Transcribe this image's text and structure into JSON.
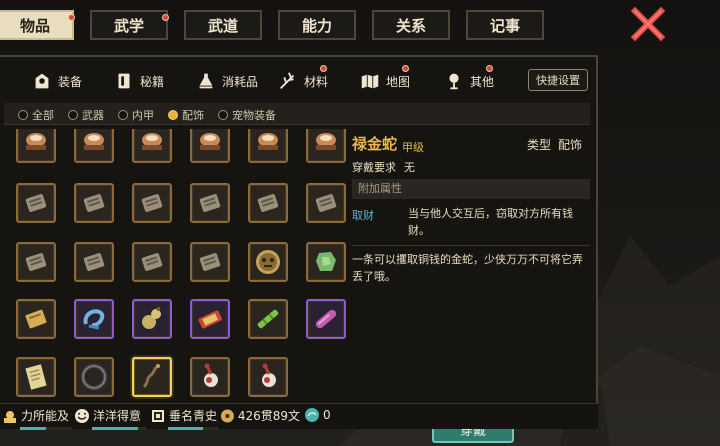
{
  "top_tabs": [
    {
      "label": "物品",
      "badge": true,
      "active": true
    },
    {
      "label": "武学",
      "badge": true,
      "active": false
    },
    {
      "label": "武道",
      "badge": false,
      "active": false
    },
    {
      "label": "能力",
      "badge": false,
      "active": false
    },
    {
      "label": "关系",
      "badge": false,
      "active": false
    },
    {
      "label": "记事",
      "badge": false,
      "active": false
    }
  ],
  "sub_tabs": [
    {
      "label": "装备",
      "icon": "armor-icon",
      "badge": false,
      "active": true
    },
    {
      "label": "秘籍",
      "icon": "book-icon",
      "badge": false,
      "active": false
    },
    {
      "label": "消耗品",
      "icon": "potion-icon",
      "badge": false,
      "active": false
    },
    {
      "label": "材料",
      "icon": "herb-icon",
      "badge": true,
      "active": false
    },
    {
      "label": "地图",
      "icon": "map-icon",
      "badge": true,
      "active": false
    },
    {
      "label": "其他",
      "icon": "misc-icon",
      "badge": true,
      "active": false
    }
  ],
  "quick_settings_label": "快捷设置",
  "filters": [
    {
      "label": "全部",
      "selected": false
    },
    {
      "label": "武器",
      "selected": false
    },
    {
      "label": "内甲",
      "selected": false
    },
    {
      "label": "配饰",
      "selected": true
    },
    {
      "label": "宠物装备",
      "selected": false
    }
  ],
  "item_grid": {
    "rows": [
      [
        "pot-icon",
        "pot-icon",
        "pot-icon",
        "pot-icon",
        "pot-icon",
        "pot-icon"
      ],
      [
        "token-icon",
        "token-icon",
        "token-icon",
        "token-icon",
        "token-icon",
        "token-icon"
      ],
      [
        "token-icon",
        "token-icon",
        "token-icon",
        "token-icon",
        "mask-icon",
        "jade-icon"
      ],
      [
        "card-icon",
        "bracelet-icon",
        "gourd-icon",
        "scroll-case-icon",
        "bamboo-icon",
        "crystal-icon"
      ],
      [
        "paper-icon",
        "ring-icon",
        "snake-icon",
        "pipa-icon",
        "pipa-icon"
      ]
    ],
    "purple_slots": [
      "3-1",
      "3-2",
      "3-3",
      "3-5"
    ],
    "selected_slot": "4-2"
  },
  "detail": {
    "name": "禄金蛇",
    "grade": "甲级",
    "type_label": "类型",
    "type_value": "配饰",
    "requirement_label": "穿戴要求",
    "requirement_value": "无",
    "attr_header": "附加属性",
    "attr_key": "取财",
    "attr_value": "当与他人交互后，窃取对方所有钱财。",
    "description": "一条可以攫取铜钱的金蛇，少侠万万不可将它弄丢了哦。",
    "wear_button": "穿戴"
  },
  "status_bar": [
    {
      "icon": "strength-icon",
      "text": "力所能及",
      "fill": 0.5
    },
    {
      "icon": "mood-icon",
      "text": "洋洋得意",
      "fill": 0.85
    },
    {
      "icon": "fame-icon",
      "text": "垂名青史",
      "fill": 0.7
    },
    {
      "icon": "coin-icon",
      "text": "426贯89文"
    },
    {
      "icon": "orb-icon",
      "text": "0"
    }
  ],
  "colors": {
    "accent_gold": "#e8b84a",
    "attr_blue": "#5fb2d6",
    "button_teal": "#2c7d6d",
    "purple_rarity": "#8e5bd0",
    "badge_red": "#d8453a"
  }
}
